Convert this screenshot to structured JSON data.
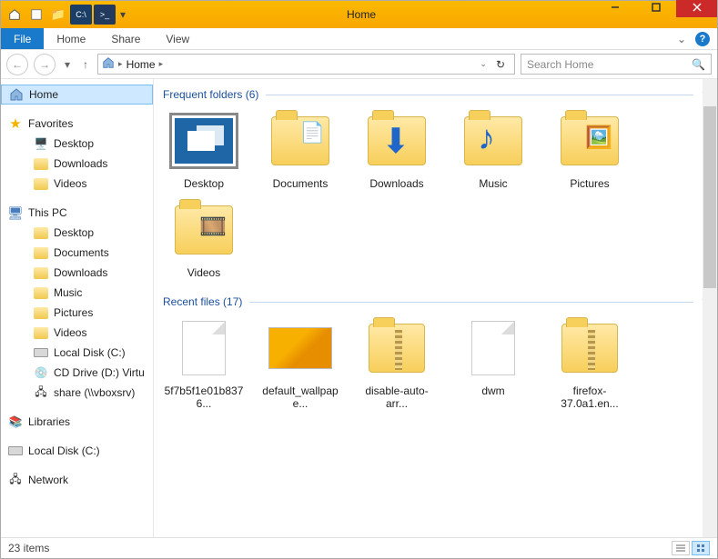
{
  "window": {
    "title": "Home"
  },
  "ribbon": {
    "file": "File",
    "tabs": [
      "Home",
      "Share",
      "View"
    ]
  },
  "breadcrumb": {
    "segments": [
      "Home"
    ]
  },
  "search": {
    "placeholder": "Search Home"
  },
  "nav": {
    "home": "Home",
    "favorites": {
      "label": "Favorites",
      "items": [
        "Desktop",
        "Downloads",
        "Videos"
      ]
    },
    "this_pc": {
      "label": "This PC",
      "items": [
        "Desktop",
        "Documents",
        "Downloads",
        "Music",
        "Pictures",
        "Videos",
        "Local Disk (C:)",
        "CD Drive (D:) Virtu",
        "share (\\\\vboxsrv)"
      ]
    },
    "libraries": "Libraries",
    "local_disk": "Local Disk (C:)",
    "network": "Network"
  },
  "groups": {
    "frequent": {
      "title": "Frequent folders",
      "count": 6,
      "items": [
        {
          "label": "Desktop",
          "kind": "desktop"
        },
        {
          "label": "Documents",
          "kind": "folder-page"
        },
        {
          "label": "Downloads",
          "kind": "folder-down"
        },
        {
          "label": "Music",
          "kind": "folder-music"
        },
        {
          "label": "Pictures",
          "kind": "folder-pic"
        },
        {
          "label": "Videos",
          "kind": "folder-video"
        }
      ]
    },
    "recent": {
      "title": "Recent files",
      "count": 17,
      "items": [
        {
          "label": "5f7b5f1e01b8376...",
          "kind": "file"
        },
        {
          "label": "default_wallpape...",
          "kind": "image"
        },
        {
          "label": "disable-auto-arr...",
          "kind": "zip"
        },
        {
          "label": "dwm",
          "kind": "file"
        },
        {
          "label": "firefox-37.0a1.en...",
          "kind": "zip"
        }
      ]
    }
  },
  "status": {
    "item_count": "23 items"
  }
}
